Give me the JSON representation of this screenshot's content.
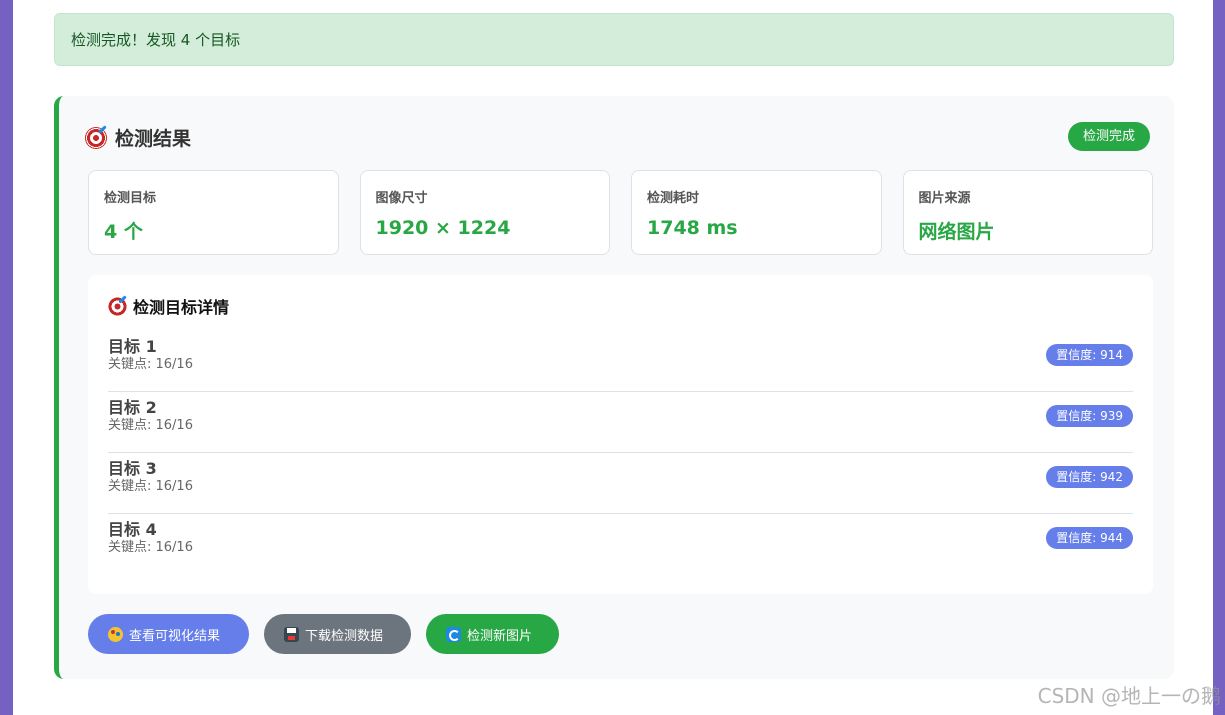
{
  "alert": {
    "text": "检测完成！发现 4 个目标"
  },
  "result": {
    "title": "检测结果",
    "status": "检测完成",
    "stats": [
      {
        "label": "检测目标",
        "value": "4 个"
      },
      {
        "label": "图像尺寸",
        "value": "1920 × 1224"
      },
      {
        "label": "检测耗时",
        "value": "1748 ms"
      },
      {
        "label": "图片来源",
        "value": "网络图片"
      }
    ],
    "details": {
      "title": "检测目标详情",
      "targets": [
        {
          "name": "目标 1",
          "keypoints": "关键点: 16/16",
          "confidence": "置信度: 914"
        },
        {
          "name": "目标 2",
          "keypoints": "关键点: 16/16",
          "confidence": "置信度: 939"
        },
        {
          "name": "目标 3",
          "keypoints": "关键点: 16/16",
          "confidence": "置信度: 942"
        },
        {
          "name": "目标 4",
          "keypoints": "关键点: 16/16",
          "confidence": "置信度: 944"
        }
      ]
    },
    "actions": {
      "view": "查看可视化结果",
      "download": "下载检测数据",
      "new": "检测新图片"
    }
  },
  "watermark": "CSDN @地上一の鹅",
  "colors": {
    "accent": "#28a745",
    "primary": "#667eea",
    "secondary": "#6c757d"
  }
}
